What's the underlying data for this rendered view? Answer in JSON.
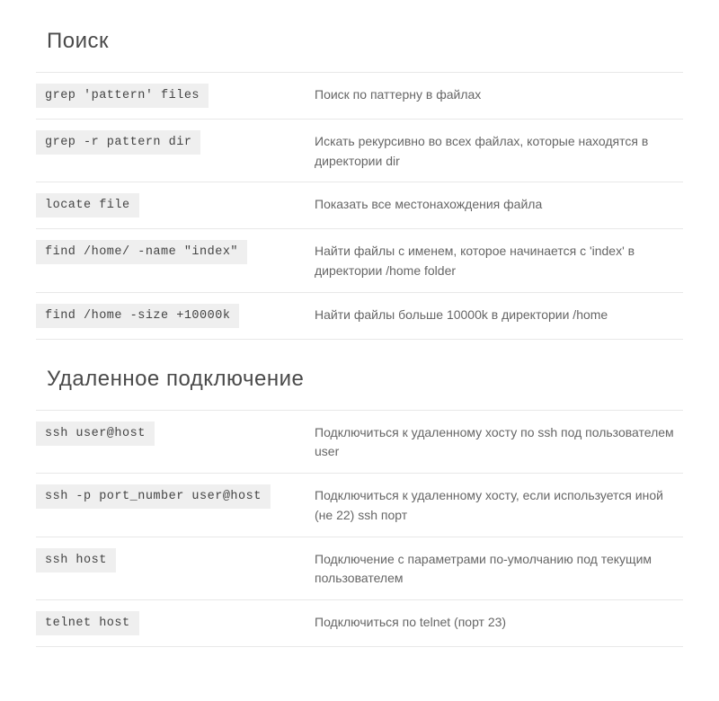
{
  "sections": [
    {
      "title": "Поиск",
      "rows": [
        {
          "cmd": "grep 'pattern' files",
          "desc": "Поиск по паттерну в файлах"
        },
        {
          "cmd": "grep -r pattern dir",
          "desc": "Искать рекурсивно во всех файлах, которые находятся в директории dir"
        },
        {
          "cmd": "locate file",
          "desc": "Показать все местонахождения файла"
        },
        {
          "cmd": "find /home/ -name \"index\"",
          "desc": "Найти файлы с именем, которое начинается с 'index' в директории /home folder"
        },
        {
          "cmd": "find /home -size +10000k",
          "desc": "Найти файлы больше 10000k в директории /home"
        }
      ]
    },
    {
      "title": "Удаленное подключение",
      "rows": [
        {
          "cmd": "ssh user@host",
          "desc": "Подключиться к удаленному хосту по ssh под пользователем user"
        },
        {
          "cmd": "ssh -p port_number user@host",
          "desc": "Подключиться к удаленному хосту, если используется иной (не 22) ssh порт"
        },
        {
          "cmd": "ssh host",
          "desc": "Подключение с параметрами по-умолчанию под текущим пользователем"
        },
        {
          "cmd": "telnet host",
          "desc": "Подключиться по telnet (порт 23)"
        }
      ]
    }
  ]
}
